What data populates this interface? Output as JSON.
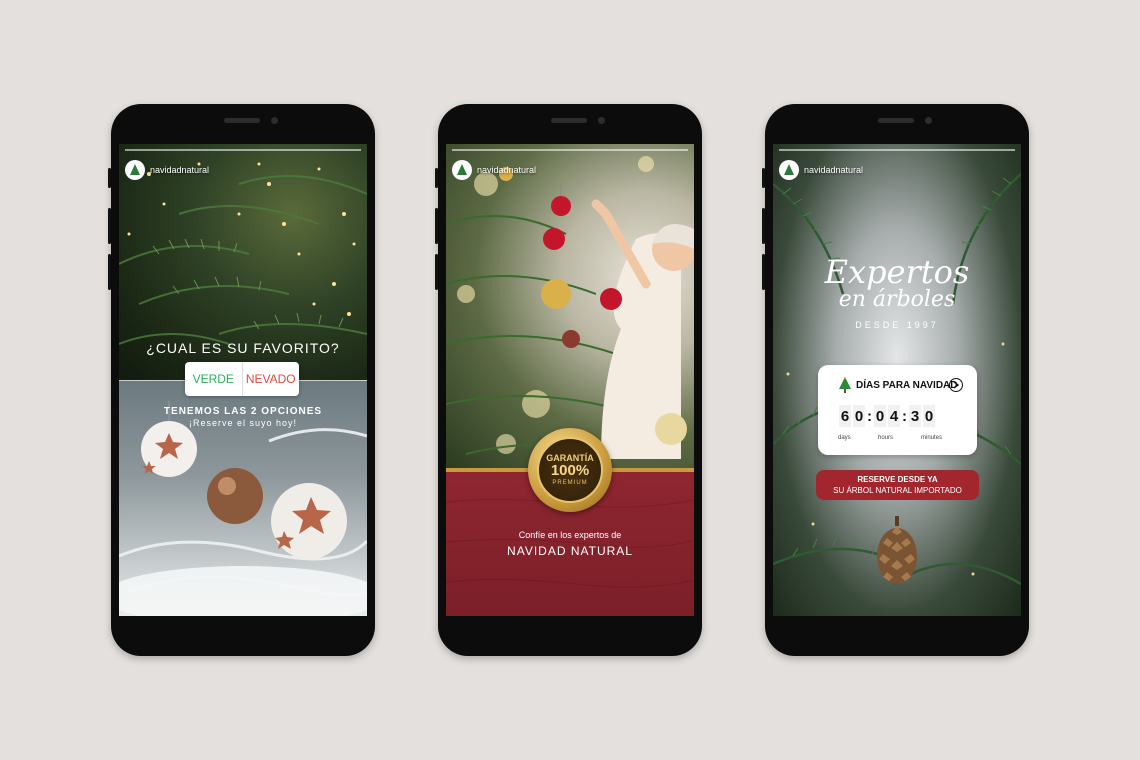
{
  "account": {
    "handle": "navidadnatural"
  },
  "story1": {
    "question": "¿CUAL ES SU FAVORITO?",
    "poll_left": "VERDE",
    "poll_right": "NEVADO",
    "line1": "TENEMOS LAS 2 OPCIONES",
    "line2": "¡Reserve el suyo hoy!"
  },
  "story2": {
    "badge_line1": "GARANTÍA",
    "badge_line2": "100%",
    "badge_line3": "PREMIUM",
    "caption1": "Confíe en los expertos de",
    "caption2": "NAVIDAD NATURAL"
  },
  "story3": {
    "title1": "Expertos",
    "title2": "en árboles",
    "since": "DESDE 1997",
    "countdown_title": "DÍAS PARA NAVIDAD",
    "digits": [
      "6",
      "0",
      "0",
      "4",
      "3",
      "0"
    ],
    "label_days": "days",
    "label_hours": "hours",
    "label_minutes": "minutes",
    "cta1": "RESERVE DESDE YA",
    "cta2": "SU ÁRBOL NATURAL IMPORTADO"
  },
  "colors": {
    "background": "#e4e0dd",
    "burgundy": "#8e2630",
    "gold": "#c89a3a",
    "poll_green": "#2eae5c",
    "poll_red": "#e04a3c"
  },
  "icons": [
    "tree-logo-icon",
    "tree-emoji-icon",
    "chevron-circle-icon",
    "pinecone-icon",
    "ornament-icon"
  ]
}
